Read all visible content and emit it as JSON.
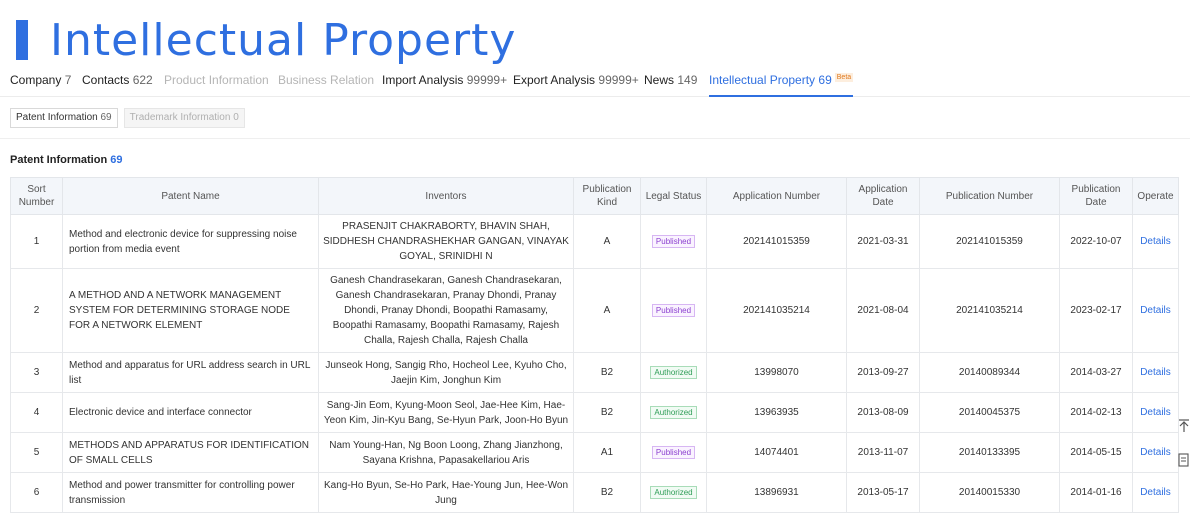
{
  "hero": {
    "title": "Intellectual Property"
  },
  "tabs": [
    {
      "label": "Company",
      "count": "7",
      "state": "normal"
    },
    {
      "label": "Contacts",
      "count": "622",
      "state": "normal"
    },
    {
      "label": "Product Information",
      "count": "",
      "state": "disabled"
    },
    {
      "label": "Business Relation",
      "count": "",
      "state": "disabled"
    },
    {
      "label": "Import Analysis",
      "count": "99999+",
      "state": "normal"
    },
    {
      "label": "Export Analysis",
      "count": "99999+",
      "state": "normal"
    },
    {
      "label": "News",
      "count": "149",
      "state": "normal"
    },
    {
      "label": "Intellectual Property",
      "count": "69",
      "state": "active",
      "badge": "Beta"
    }
  ],
  "subtabs": [
    {
      "label": "Patent Information",
      "count": "69",
      "state": "normal"
    },
    {
      "label": "Trademark Information",
      "count": "0",
      "state": "disabled"
    }
  ],
  "section": {
    "title": "Patent Information",
    "count": "69"
  },
  "table": {
    "headers": {
      "sort": "Sort Number",
      "name": "Patent Name",
      "inventors": "Inventors",
      "kind": "Publication Kind",
      "status": "Legal Status",
      "app_no": "Application Number",
      "app_date": "Application Date",
      "pub_no": "Publication Number",
      "pub_date": "Publication Date",
      "operate": "Operate"
    },
    "rows": [
      {
        "sort": "1",
        "name": "Method and electronic device for suppressing noise portion from media event",
        "inventors": "PRASENJIT CHAKRABORTY, BHAVIN SHAH, SIDDHESH CHANDRASHEKHAR GANGAN, VINAYAK GOYAL, SRINIDHI N",
        "kind": "A",
        "status": "Published",
        "app_no": "202141015359",
        "app_date": "2021-03-31",
        "pub_no": "202141015359",
        "pub_date": "2022-10-07",
        "operate": "Details"
      },
      {
        "sort": "2",
        "name": "A METHOD AND A NETWORK MANAGEMENT SYSTEM FOR DETERMINING STORAGE NODE FOR A NETWORK ELEMENT",
        "inventors": "Ganesh Chandrasekaran, Ganesh Chandrasekaran, Ganesh Chandrasekaran, Pranay Dhondi, Pranay Dhondi, Pranay Dhondi, Boopathi Ramasamy, Boopathi Ramasamy, Boopathi Ramasamy, Rajesh Challa, Rajesh Challa, Rajesh Challa",
        "kind": "A",
        "status": "Published",
        "app_no": "202141035214",
        "app_date": "2021-08-04",
        "pub_no": "202141035214",
        "pub_date": "2023-02-17",
        "operate": "Details"
      },
      {
        "sort": "3",
        "name": "Method and apparatus for URL address search in URL list",
        "inventors": "Junseok Hong, Sangig Rho, Hocheol Lee, Kyuho Cho, Jaejin Kim, Jonghun Kim",
        "kind": "B2",
        "status": "Authorized",
        "app_no": "13998070",
        "app_date": "2013-09-27",
        "pub_no": "20140089344",
        "pub_date": "2014-03-27",
        "operate": "Details"
      },
      {
        "sort": "4",
        "name": "Electronic device and interface connector",
        "inventors": "Sang-Jin Eom, Kyung-Moon Seol, Jae-Hee Kim, Hae-Yeon Kim, Jin-Kyu Bang, Se-Hyun Park, Joon-Ho Byun",
        "kind": "B2",
        "status": "Authorized",
        "app_no": "13963935",
        "app_date": "2013-08-09",
        "pub_no": "20140045375",
        "pub_date": "2014-02-13",
        "operate": "Details"
      },
      {
        "sort": "5",
        "name": "METHODS AND APPARATUS FOR IDENTIFICATION OF SMALL CELLS",
        "inventors": "Nam Young-Han, Ng Boon Loong, Zhang Jianzhong, Sayana Krishna, Papasakellariou Aris",
        "kind": "A1",
        "status": "Published",
        "app_no": "14074401",
        "app_date": "2013-11-07",
        "pub_no": "20140133395",
        "pub_date": "2014-05-15",
        "operate": "Details"
      },
      {
        "sort": "6",
        "name": "Method and power transmitter for controlling power transmission",
        "inventors": "Kang-Ho Byun, Se-Ho Park, Hae-Young Jun, Hee-Won Jung",
        "kind": "B2",
        "status": "Authorized",
        "app_no": "13896931",
        "app_date": "2013-05-17",
        "pub_no": "20140015330",
        "pub_date": "2014-01-16",
        "operate": "Details"
      }
    ]
  },
  "float_tools": {
    "top_icon": "arrow-up-to-top-icon",
    "doc_icon": "document-list-icon"
  },
  "colors": {
    "accent": "#2f6fe0",
    "published": "#8b3fcf",
    "authorized": "#2e9d57"
  }
}
